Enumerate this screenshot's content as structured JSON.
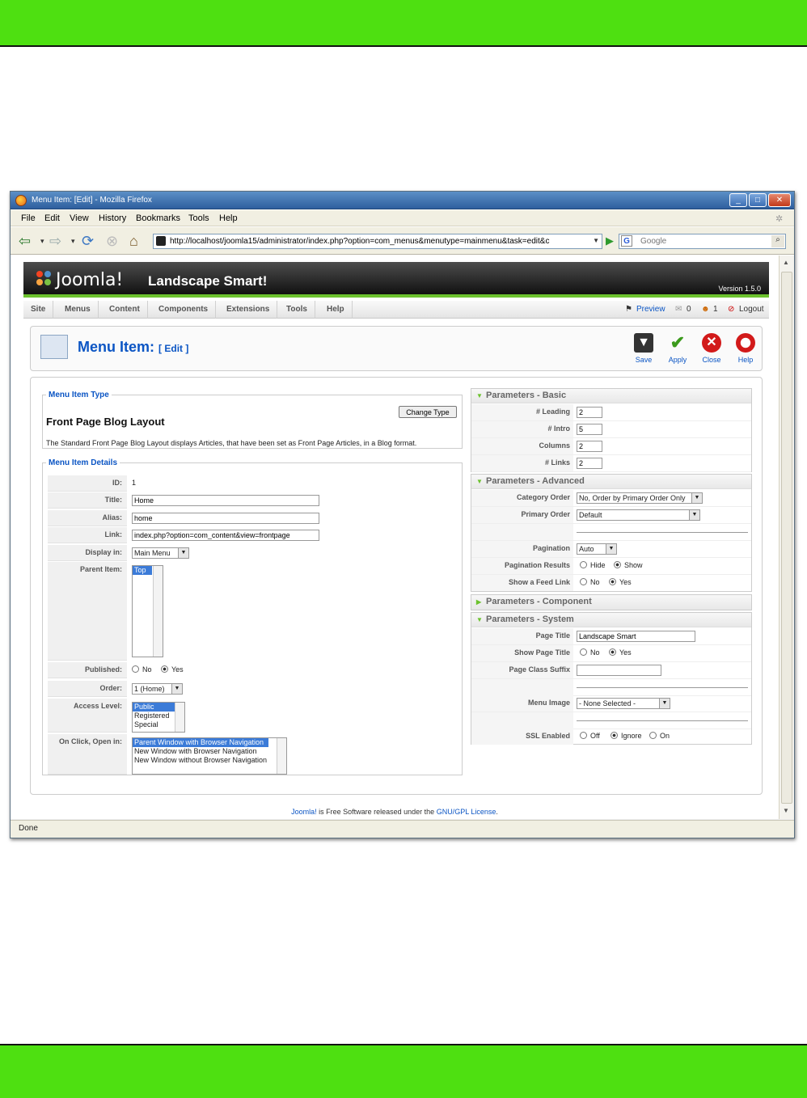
{
  "browser": {
    "title": "Menu Item: [Edit] - Mozilla Firefox",
    "controls": {
      "minimize": "_",
      "maximize": "□",
      "close": "✕"
    },
    "menu": [
      "File",
      "Edit",
      "View",
      "History",
      "Bookmarks",
      "Tools",
      "Help"
    ],
    "url": "http://localhost/joomla15/administrator/index.php?option=com_menus&menutype=mainmenu&task=edit&c",
    "search_placeholder": "Google",
    "status": "Done"
  },
  "joomla": {
    "logo": "Joomla!",
    "site_name": "Landscape Smart!",
    "version": "Version 1.5.0",
    "menu": [
      "Site",
      "Menus",
      "Content",
      "Components",
      "Extensions",
      "Tools",
      "Help"
    ],
    "preview": "Preview",
    "messages": "0",
    "users": "1",
    "logout": "Logout"
  },
  "toolbar": {
    "title": "Menu Item:",
    "subtitle": "[ Edit ]",
    "save": "Save",
    "apply": "Apply",
    "close": "Close",
    "help": "Help"
  },
  "type": {
    "legend": "Menu Item Type",
    "name": "Front Page Blog Layout",
    "change_button": "Change Type",
    "description": "The Standard Front Page Blog Layout displays Articles, that have been set as Front Page Articles, in a Blog format."
  },
  "details": {
    "legend": "Menu Item Details",
    "id_label": "ID:",
    "id_value": "1",
    "title_label": "Title:",
    "title_value": "Home",
    "alias_label": "Alias:",
    "alias_value": "home",
    "link_label": "Link:",
    "link_value": "index.php?option=com_content&view=frontpage",
    "display_label": "Display in:",
    "display_value": "Main Menu",
    "parent_label": "Parent Item:",
    "parent_value": "Top",
    "published_label": "Published:",
    "no": "No",
    "yes": "Yes",
    "order_label": "Order:",
    "order_value": "1 (Home)",
    "access_label": "Access Level:",
    "access_options": [
      "Public",
      "Registered",
      "Special"
    ],
    "onclick_label": "On Click, Open in:",
    "onclick_options": [
      "Parent Window with Browser Navigation",
      "New Window with Browser Navigation",
      "New Window without Browser Navigation"
    ]
  },
  "params_basic": {
    "title": "Parameters - Basic",
    "leading_label": "# Leading",
    "leading_value": "2",
    "intro_label": "# Intro",
    "intro_value": "5",
    "columns_label": "Columns",
    "columns_value": "2",
    "links_label": "# Links",
    "links_value": "2"
  },
  "params_advanced": {
    "title": "Parameters - Advanced",
    "category_order_label": "Category Order",
    "category_order_value": "No, Order by Primary Order Only",
    "primary_order_label": "Primary Order",
    "primary_order_value": "Default",
    "pagination_label": "Pagination",
    "pagination_value": "Auto",
    "pagination_results_label": "Pagination Results",
    "hide": "Hide",
    "show": "Show",
    "feed_label": "Show a Feed Link",
    "no": "No",
    "yes": "Yes"
  },
  "params_component": {
    "title": "Parameters - Component"
  },
  "params_system": {
    "title": "Parameters - System",
    "page_title_label": "Page Title",
    "page_title_value": "Landscape Smart",
    "show_page_title_label": "Show Page Title",
    "no": "No",
    "yes": "Yes",
    "page_class_label": "Page Class Suffix",
    "menu_image_label": "Menu Image",
    "menu_image_value": "- None Selected -",
    "ssl_label": "SSL Enabled",
    "off": "Off",
    "ignore": "Ignore",
    "on": "On"
  },
  "footer": {
    "brand": "Joomla!",
    "text": " is Free Software released under the ",
    "license": "GNU/GPL License",
    "end": "."
  }
}
